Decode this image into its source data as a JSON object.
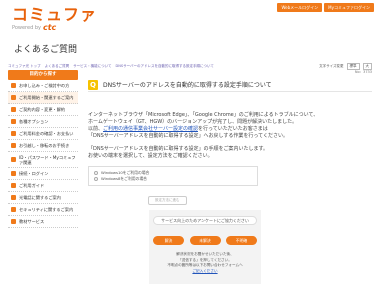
{
  "logo": {
    "main": "コミュファ",
    "sub": "Powered by",
    "brand": "ctc"
  },
  "header_buttons": [
    "Webメールログイン",
    "Myコミュファログイン"
  ],
  "page_title": "よくあるご質問",
  "breadcrumb": {
    "links": [
      "コミュファ光 トップ",
      "よくあるご質問",
      "サービス・機能について",
      "DNSサーバーのアドレスを自動的に取得する設定手順について"
    ],
    "font_size_label": "文字サイズ変更",
    "font_sizes": [
      "標準",
      "大"
    ]
  },
  "sidebar": {
    "heading": "目的から探す",
    "items": [
      "お申し込み・ご検討中の方",
      "ご利用開始・関連するご案内",
      "ご契約内容・変更・解約",
      "各種オプション",
      "ご利用料金の確認・お支払い",
      "お引越し・移転のお手続き",
      "ID・パスワード・Myコミュファ関連",
      "接続・ログイン",
      "ご利用ガイド",
      "光電話に関するご案内",
      "セキュリティに関するご案内",
      "教材サービス"
    ]
  },
  "article": {
    "meta": "No：3733",
    "badge": "Q",
    "title": "DNSサーバーのアドレスを自動的に取得する設定手順について",
    "paragraphs": [
      "インターネットブラウザ「Microsoft Edge」、「Google Chrome」のご利用によるトラブルについて、",
      "ホームゲートウェイ（GT、HGW）のバージョンアップが完了し、問題が解決いたしました。",
      "以前、",
      "ご利用の通信事業会社サーバー設定の確認",
      "を行っていただいたお客さまは",
      "「DNSサーバーアドレスを自動的に取得する設定」へお戻しする作業を行ってください。",
      "「DNSサーバーアドレスを自動的に取得する設定」の手順をご案内いたします。",
      "お使いの端末を選択して、設定方法をご確認ください。"
    ],
    "choices": [
      "Windows10をご利用の場合",
      "Windows8をご利用の場合"
    ],
    "pill_button": "設定方法に進む"
  },
  "survey": {
    "title": "サービス向上のためアンケートにご協力ください",
    "buttons": [
      "解決",
      "未解決",
      "不明確"
    ],
    "note_lines": [
      "解決状況をお聞かせいただいた後、",
      "「送信する」を押してください。",
      "不明点の箇所等は以下お問い合わせフォームへ",
      "ご記入ください"
    ],
    "link_text": "ご記入ください"
  }
}
